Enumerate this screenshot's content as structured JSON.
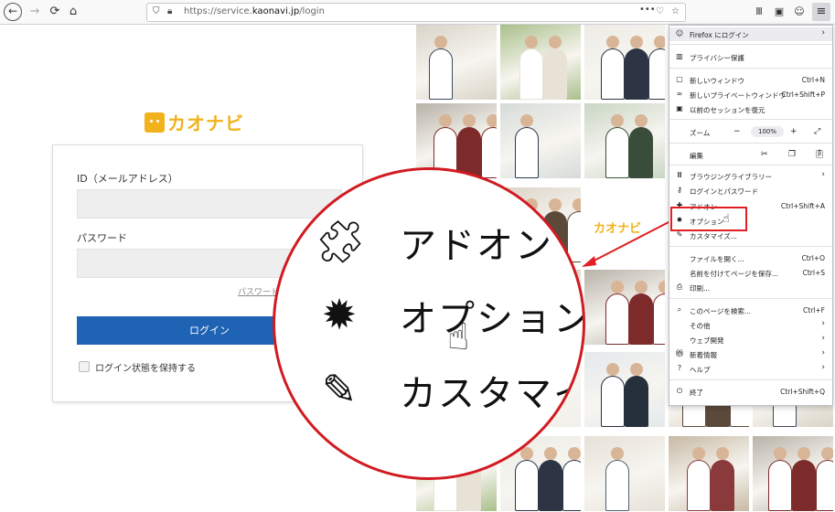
{
  "browser": {
    "url_prefix": "https://service.",
    "url_domain": "kaonavi.jp",
    "url_path": "/login",
    "back_icon": "back-arrow-icon",
    "forward_icon": "forward-arrow-icon",
    "reload_icon": "reload-icon",
    "home_icon": "home-icon",
    "page_actions": "•••"
  },
  "page": {
    "logo_text": "カオナビ",
    "id_label": "ID（メールアドレス）",
    "password_label": "パスワード",
    "forgot_link": "パスワードを",
    "login_button": "ログイン",
    "keep_logged_in": "ログイン状態を保持する",
    "center_logo_text": "カオナビ"
  },
  "menu": {
    "signin": "Firefox にログイン",
    "privacy": "プライバシー保護",
    "new_window": "新しいウィンドウ",
    "new_window_sc": "Ctrl+N",
    "private_window": "新しいプライベートウィンドウ",
    "private_window_sc": "Ctrl+Shift+P",
    "restore_session": "以前のセッションを復元",
    "zoom": "ズーム",
    "zoom_minus": "−",
    "zoom_value": "100%",
    "zoom_plus": "+",
    "edit": "編集",
    "library": "ブラウジングライブラリー",
    "logins": "ログインとパスワード",
    "addons": "アドオン",
    "addons_sc": "Ctrl+Shift+A",
    "options": "オプション",
    "customize": "カスタマイズ...",
    "open_file": "ファイルを開く...",
    "open_file_sc": "Ctrl+O",
    "save_page": "名前を付けてページを保存...",
    "save_page_sc": "Ctrl+S",
    "print": "印刷...",
    "find": "このページを検索...",
    "find_sc": "Ctrl+F",
    "more": "その他",
    "web_dev": "ウェブ開発",
    "whats_new": "新着情報",
    "help": "ヘルプ",
    "exit": "終了",
    "exit_sc": "Ctrl+Shift+Q"
  },
  "magnifier": {
    "addons": "アドオン",
    "options": "オプション",
    "customize": "カスタマイズ"
  },
  "colors": {
    "accent_red": "#e01e24",
    "login_blue": "#1f63b5",
    "logo_yellow": "#f2b21b"
  }
}
